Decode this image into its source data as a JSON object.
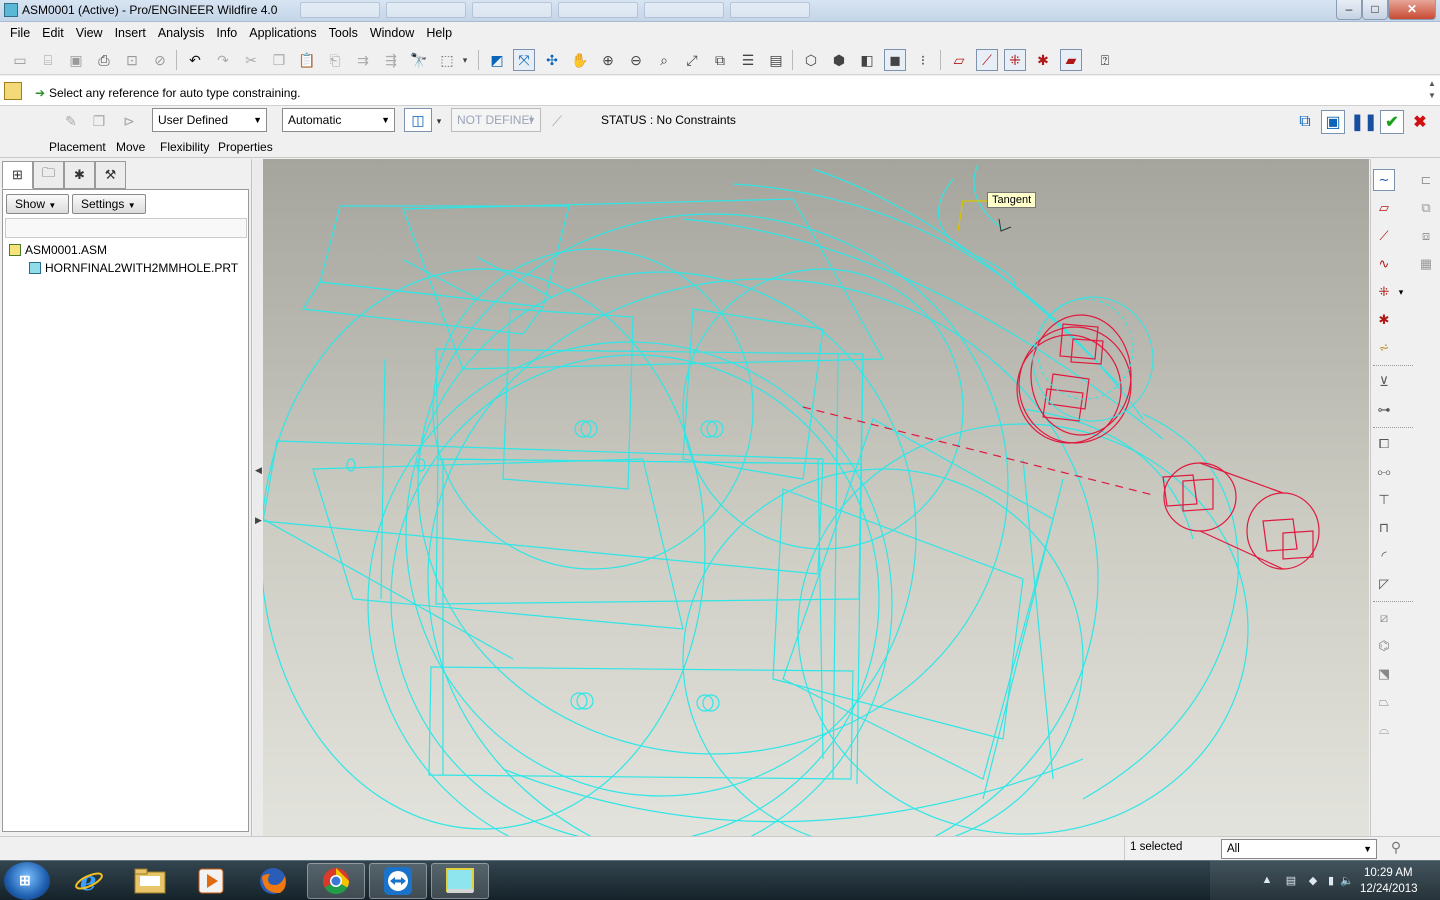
{
  "window": {
    "title": "ASM0001 (Active) - Pro/ENGINEER Wildfire 4.0",
    "controls": {
      "minimize": "–",
      "maximize": "□",
      "close": "✕"
    }
  },
  "menubar": {
    "items": [
      "File",
      "Edit",
      "View",
      "Insert",
      "Analysis",
      "Info",
      "Applications",
      "Tools",
      "Window",
      "Help"
    ]
  },
  "toolbar": {
    "icons": [
      "new-icon",
      "open-icon",
      "save-icon",
      "print-icon",
      "save-copy-icon",
      "erase-icon",
      "undo-icon",
      "redo-icon",
      "cut-icon",
      "copy-icon",
      "paste-icon",
      "paste-special-icon",
      "regenerate-icon",
      "find-icon",
      "select-box-icon",
      "datum-display-icon",
      "spin-center-icon",
      "orient-icon",
      "pan-icon",
      "zoom-in-icon",
      "zoom-out-icon",
      "refit-icon",
      "reorient-icon",
      "saved-views-icon",
      "layers-icon",
      "appearance-icon",
      "wireframe-icon",
      "hidden-line-icon",
      "no-hidden-icon",
      "shading-icon",
      "model-tree-icon",
      "datum-planes-icon",
      "datum-axes-icon",
      "datum-points-icon",
      "coordinate-systems-icon",
      "spin-center-toggle-icon",
      "context-help-icon"
    ]
  },
  "prompt": {
    "message": "Select any reference for auto type constraining."
  },
  "dashboard": {
    "constraint_set": "User Defined",
    "constraint_type": "Automatic",
    "offset": "NOT DEFINEI",
    "status": "STATUS : No Constraints",
    "tabs": [
      "Placement",
      "Move",
      "Flexibility",
      "Properties"
    ],
    "right_icons": [
      "preview-window-icon",
      "preview-model-icon",
      "pause-icon",
      "accept-icon",
      "cancel-icon"
    ]
  },
  "model_tree": {
    "tabs": [
      "model-tree-tab-icon",
      "folder-browser-tab-icon",
      "favorites-tab-icon",
      "connections-tab-icon"
    ],
    "show_label": "Show",
    "settings_label": "Settings",
    "items": [
      {
        "label": "ASM0001.ASM",
        "type": "assembly"
      },
      {
        "label": "HORNFINAL2WITH2MMHOLE.PRT",
        "type": "part"
      }
    ]
  },
  "graphics": {
    "tag_label": "Tangent",
    "assembly_color": "#2ee6e6",
    "component_color": "#e0193f"
  },
  "status_bar": {
    "selection": "1 selected",
    "filter": "All"
  },
  "taskbar": {
    "apps": [
      "windows-explorer",
      "internet-explorer",
      "file-explorer",
      "media-player",
      "firefox",
      "chrome",
      "teamviewer",
      "pro-engineer"
    ],
    "time": "10:29 AM",
    "date": "12/24/2013"
  }
}
